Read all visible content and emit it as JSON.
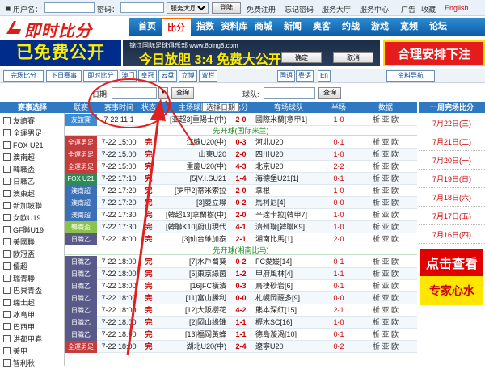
{
  "topbar": {
    "username_label": "用户名：",
    "password_label": "密码：",
    "service_select": "服务大厅",
    "login_button": "登陆",
    "links": [
      "免费注册",
      "忘记密码",
      "服务大厅",
      "服务中心"
    ],
    "right_links": [
      "广告",
      "收藏",
      "English"
    ]
  },
  "header": {
    "logo": "即时比分",
    "nav": [
      "首页",
      "比分",
      "指数",
      "资料库",
      "商城",
      "新闻",
      "奥客",
      "约战",
      "游戏",
      "宽频",
      "论坛"
    ],
    "active_nav": "比分"
  },
  "banners": {
    "left": "已免费公开",
    "mid_title": "锦江国际足球俱乐部 www.8bing8.com",
    "mid_main": "今日放胆 3:4 免费大公开",
    "mid_ok": "确定",
    "mid_cancel": "取消",
    "right": "合理安排下注"
  },
  "filters": {
    "left": [
      "完场比分",
      "下日赛事",
      "即时比分",
      "澳门",
      "皇冠",
      "云盘",
      "立博",
      "双栏"
    ],
    "langs": [
      "国语",
      "粤语",
      "En"
    ],
    "nav_select": "资料导航"
  },
  "daterow": {
    "date_label": "日期:",
    "query_button": "查询",
    "team_label": "球队:",
    "query_button2": "查询"
  },
  "sidebar": {
    "title": "赛事选择",
    "items": [
      "友誼賽",
      "全運男足",
      "FOX U21",
      "澳南超",
      "韓職盃",
      "日職乙",
      "澳東超",
      "新加坡聯",
      "女欧U19",
      "GF聯U19",
      "美國聯",
      "欧冠盃",
      "優超",
      "瑞青聯",
      "巴貝青盃",
      "瑞士超",
      "冰島甲",
      "巴西甲",
      "洪都甲春",
      "美甲",
      "智利秋"
    ]
  },
  "table": {
    "headers": [
      "联赛",
      "赛事时间",
      "状态",
      "主场球队",
      "比分",
      "客场球队",
      "半场",
      "数据"
    ],
    "date_popup": "选择日期",
    "rows": [
      {
        "league": "友誼賽",
        "color": "#3b8cd3",
        "time": "7-22 11:1",
        "status": "",
        "home": "[亚超3]重陽士(中)",
        "score": "2-0",
        "away": "國際米蘭[意甲1]",
        "half": "1-0",
        "data": "析 亚 欧"
      },
      {
        "sep": "先开球(国际米兰)"
      },
      {
        "league": "全運男足",
        "color": "#c43c3c",
        "time": "7-22 15:00",
        "status": "完",
        "home": "江蘇U20(中)",
        "score": "0-3",
        "away": "河北U20",
        "half": "0-1",
        "data": "析 亚 欧"
      },
      {
        "league": "全運男足",
        "color": "#c43c3c",
        "time": "7-22 15:00",
        "status": "完",
        "home": "山東U20",
        "score": "2-0",
        "away": "四川U20",
        "half": "1-0",
        "data": "析 亚 欧"
      },
      {
        "league": "全運男足",
        "color": "#c43c3c",
        "time": "7-22 15:00",
        "status": "完",
        "home": "重慶U20(中)",
        "score": "4-3",
        "away": "北京U20",
        "half": "2-2",
        "data": "析 亚 欧"
      },
      {
        "league": "FOX U21",
        "color": "#2e8b57",
        "time": "7-22 17:10",
        "status": "完",
        "home": "[5]V.I.SU21",
        "score": "1-4",
        "away": "海德堡U21[1]",
        "half": "0-1",
        "data": "析 亚 欧"
      },
      {
        "league": "澳南超",
        "color": "#3b6fb6",
        "time": "7-22 17:20",
        "status": "完",
        "home": "[罗甲2]蒂米索拉",
        "score": "2-0",
        "away": "拿根",
        "half": "1-0",
        "data": "析 亚 欧"
      },
      {
        "league": "澳南超",
        "color": "#3b6fb6",
        "time": "7-22 17:20",
        "status": "完",
        "home": "[3]曼立聯",
        "score": "0-2",
        "away": "馬柯尼[4]",
        "half": "0-0",
        "data": "析 亚 欧"
      },
      {
        "league": "澳南超",
        "color": "#3b6fb6",
        "time": "7-22 17:30",
        "status": "完",
        "home": "[韓超13]拿蘭樹(中)",
        "score": "2-0",
        "away": "辛達卡拉[韓甲7]",
        "half": "1-0",
        "data": "析 亚 欧"
      },
      {
        "league": "韓職盃",
        "color": "#8bc34a",
        "time": "7-22 17:30",
        "status": "完",
        "home": "[韓聯K10]蔚山現代",
        "score": "4-1",
        "away": "濟州聯[韓聯K9]",
        "half": "1-0",
        "data": "析 亚 欧"
      },
      {
        "league": "日職乙",
        "color": "#5a5a8a",
        "time": "7-22 18:00",
        "status": "完",
        "home": "[3]仙台維加泰",
        "score": "2-1",
        "away": "湘南比馬[1]",
        "half": "2-0",
        "data": "析 亚 欧"
      },
      {
        "sep": "先开球(湘南比马)"
      },
      {
        "league": "日職乙",
        "color": "#5a5a8a",
        "time": "7-22 18:00",
        "status": "完",
        "home": "[7]水戶蜀葵",
        "score": "0-2",
        "away": "FC愛媛[14]",
        "half": "0-1",
        "data": "析 亚 欧"
      },
      {
        "league": "日職乙",
        "color": "#5a5a8a",
        "time": "7-22 18:00",
        "status": "完",
        "home": "[5]東京綠茵",
        "score": "1-2",
        "away": "甲府風林[4]",
        "half": "1-1",
        "data": "析 亚 欧"
      },
      {
        "league": "日職乙",
        "color": "#5a5a8a",
        "time": "7-22 18:00",
        "status": "完",
        "home": "[16]FC橫濱",
        "score": "0-3",
        "away": "鳥棲砂岩[6]",
        "half": "0-1",
        "data": "析 亚 欧"
      },
      {
        "league": "日職乙",
        "color": "#5a5a8a",
        "time": "7-22 18:00",
        "status": "完",
        "home": "[11]富山勝利",
        "score": "0-0",
        "away": "札幌岡薩多[9]",
        "half": "0-0",
        "data": "析 亚 欧"
      },
      {
        "league": "日職乙",
        "color": "#5a5a8a",
        "time": "7-22 18:00",
        "status": "完",
        "home": "[12]大阪櫻花",
        "score": "4-2",
        "away": "熊本深紅[15]",
        "half": "2-1",
        "data": "析 亚 欧"
      },
      {
        "league": "日職乙",
        "color": "#5a5a8a",
        "time": "7-22 18:00",
        "status": "完",
        "home": "[2]岡山綠雉",
        "score": "1-1",
        "away": "櫪木SC[16]",
        "half": "1-0",
        "data": "析 亚 欧"
      },
      {
        "league": "日職乙",
        "color": "#5a5a8a",
        "time": "7-22 18:00",
        "status": "完",
        "home": "[13]福岡黃蜂",
        "score": "1-1",
        "away": "德島漩渦[10]",
        "half": "0-1",
        "data": "析 亚 欧"
      },
      {
        "league": "全運男足",
        "color": "#c43c3c",
        "time": "7-22 18:00",
        "status": "完",
        "home": "湖北U20(中)",
        "score": "2-4",
        "away": "遼寧U20",
        "half": "0-2",
        "data": "析 亚 欧"
      }
    ]
  },
  "right_panel": {
    "title": "一周完场比分",
    "dates": [
      "7月22日(三)",
      "7月21日(二)",
      "7月20日(一)",
      "7月19日(日)",
      "7月18日(六)",
      "7月17日(五)",
      "7月16日(四)"
    ],
    "ad1": "点击查看",
    "ad2": "专家心水"
  }
}
